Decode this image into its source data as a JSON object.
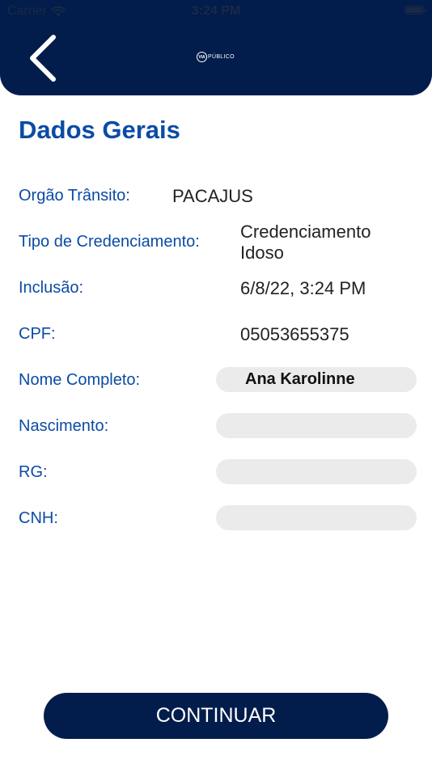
{
  "status_bar": {
    "carrier": "Carrier",
    "time": "3:24 PM"
  },
  "header": {
    "logo_mark": "VIA",
    "logo_text": "PÚBLICO"
  },
  "page_title": "Dados Gerais",
  "fields": [
    {
      "label": "Orgão Trânsito:",
      "value": "PACAJUS"
    },
    {
      "label": "Tipo de Credenciamento:",
      "value_line1": "Credenciamento",
      "value_line2": "Idoso"
    },
    {
      "label": "Inclusão:",
      "value": "6/8/22, 3:24 PM"
    },
    {
      "label": "CPF:",
      "value": "05053655375"
    },
    {
      "label": "Nome Completo:",
      "value": "Ana Karolinne"
    },
    {
      "label": "Nascimento:",
      "value": ""
    },
    {
      "label": "RG:",
      "value": ""
    },
    {
      "label": "CNH:",
      "value": ""
    }
  ],
  "continue_label": "CONTINUAR",
  "colors": {
    "header_bg": "#021D4C",
    "accent": "#0B4BA5",
    "pill_bg": "#EBEBEB"
  }
}
